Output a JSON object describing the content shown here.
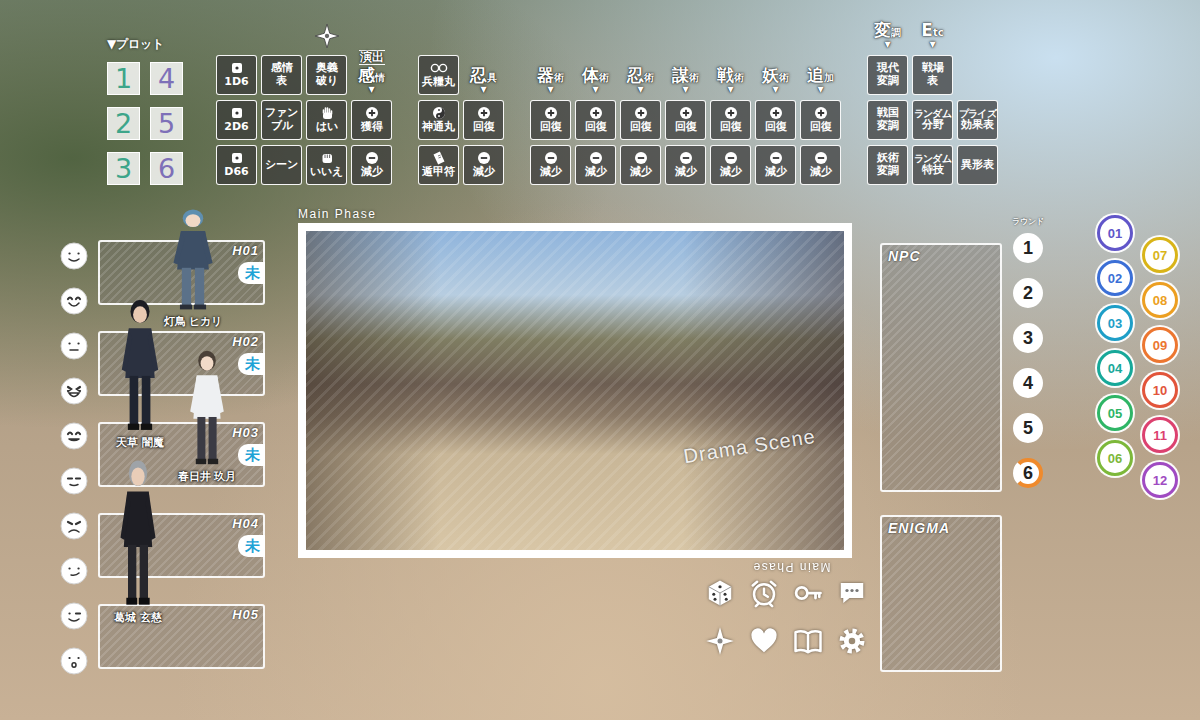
{
  "plot": {
    "title": "▼プロット",
    "numbers": [
      {
        "label": "1",
        "color": "#3da58a"
      },
      {
        "label": "2",
        "color": "#3da58a"
      },
      {
        "label": "3",
        "color": "#3da58a"
      },
      {
        "label": "4",
        "color": "#7e70b8"
      },
      {
        "label": "5",
        "color": "#7e70b8"
      },
      {
        "label": "6",
        "color": "#7e70b8"
      }
    ]
  },
  "toolGroups": [
    {
      "columns": [
        {
          "header": null,
          "buttons": [
            {
              "kind": "dice",
              "lines": [
                "1D6"
              ]
            },
            {
              "kind": "dice",
              "lines": [
                "2D6"
              ]
            },
            {
              "kind": "dice",
              "lines": [
                "D66"
              ]
            }
          ]
        },
        {
          "header": null,
          "buttons": [
            {
              "kind": "text",
              "lines": [
                "感情",
                "表"
              ]
            },
            {
              "kind": "text",
              "lines": [
                "ファン",
                "ブル"
              ]
            },
            {
              "kind": "text",
              "lines": [
                "シーン"
              ]
            }
          ]
        },
        {
          "header": {
            "kind": "shuriken"
          },
          "buttons": [
            {
              "kind": "text",
              "lines": [
                "奥義",
                "破り"
              ]
            },
            {
              "kind": "hand",
              "lines": [
                "はい"
              ]
            },
            {
              "kind": "fist",
              "lines": [
                "いいえ"
              ]
            }
          ]
        },
        {
          "header": {
            "kind": "text",
            "top": "演出",
            "main": "感",
            "sub": "情",
            "arrow": "▼"
          },
          "buttons": [
            {
              "kind": "plus",
              "lines": [
                "獲得"
              ]
            },
            {
              "kind": "minus",
              "lines": [
                "減少"
              ]
            }
          ]
        }
      ]
    },
    {
      "columns": [
        {
          "header": null,
          "buttons": [
            {
              "kind": "pill",
              "lines": [
                "兵糧丸"
              ]
            },
            {
              "kind": "yinyang",
              "lines": [
                "神通丸"
              ]
            },
            {
              "kind": "charm",
              "lines": [
                "遁甲符"
              ]
            }
          ]
        },
        {
          "header": {
            "kind": "text",
            "main": "忍",
            "sub": "具",
            "arrow": "▼"
          },
          "buttons": [
            {
              "kind": "plus",
              "lines": [
                "回復"
              ]
            },
            {
              "kind": "minus",
              "lines": [
                "減少"
              ]
            }
          ]
        }
      ]
    },
    {
      "columns": [
        {
          "header": {
            "kind": "text",
            "main": "器",
            "sub": "術",
            "arrow": "▼"
          },
          "buttons": [
            {
              "kind": "plus",
              "lines": [
                "回復"
              ]
            },
            {
              "kind": "minus",
              "lines": [
                "減少"
              ]
            }
          ]
        },
        {
          "header": {
            "kind": "text",
            "main": "体",
            "sub": "術",
            "arrow": "▼"
          },
          "buttons": [
            {
              "kind": "plus",
              "lines": [
                "回復"
              ]
            },
            {
              "kind": "minus",
              "lines": [
                "減少"
              ]
            }
          ]
        },
        {
          "header": {
            "kind": "text",
            "main": "忍",
            "sub": "術",
            "arrow": "▼"
          },
          "buttons": [
            {
              "kind": "plus",
              "lines": [
                "回復"
              ]
            },
            {
              "kind": "minus",
              "lines": [
                "減少"
              ]
            }
          ]
        },
        {
          "header": {
            "kind": "text",
            "main": "謀",
            "sub": "術",
            "arrow": "▼"
          },
          "buttons": [
            {
              "kind": "plus",
              "lines": [
                "回復"
              ]
            },
            {
              "kind": "minus",
              "lines": [
                "減少"
              ]
            }
          ]
        },
        {
          "header": {
            "kind": "text",
            "main": "戦",
            "sub": "術",
            "arrow": "▼"
          },
          "buttons": [
            {
              "kind": "plus",
              "lines": [
                "回復"
              ]
            },
            {
              "kind": "minus",
              "lines": [
                "減少"
              ]
            }
          ]
        },
        {
          "header": {
            "kind": "text",
            "main": "妖",
            "sub": "術",
            "arrow": "▼"
          },
          "buttons": [
            {
              "kind": "plus",
              "lines": [
                "回復"
              ]
            },
            {
              "kind": "minus",
              "lines": [
                "減少"
              ]
            }
          ]
        },
        {
          "header": {
            "kind": "text",
            "main": "追",
            "sub": "加",
            "arrow": "▼"
          },
          "buttons": [
            {
              "kind": "plus",
              "lines": [
                "回復"
              ]
            },
            {
              "kind": "minus",
              "lines": [
                "減少"
              ]
            }
          ]
        }
      ]
    },
    {
      "columns": [
        {
          "header": {
            "kind": "text",
            "main": "変",
            "sub": "調",
            "arrow": "▼"
          },
          "buttons": [
            {
              "kind": "text",
              "lines": [
                "現代",
                "変調"
              ]
            },
            {
              "kind": "text",
              "lines": [
                "戦国",
                "変調"
              ]
            },
            {
              "kind": "text",
              "lines": [
                "妖術",
                "変調"
              ]
            }
          ]
        },
        {
          "header": {
            "kind": "text",
            "main": "E",
            "sub": "tc",
            "arrow": "▼"
          },
          "buttons": [
            {
              "kind": "text",
              "lines": [
                "戦場",
                "表"
              ]
            },
            {
              "kind": "text",
              "lines": [
                "ランダム",
                "分野"
              ]
            },
            {
              "kind": "text",
              "lines": [
                "ランダム",
                "特技"
              ]
            }
          ]
        },
        {
          "header": null,
          "buttons": [
            {
              "kind": "text",
              "lines": [
                "プライズ",
                "効果表"
              ]
            },
            {
              "kind": "text",
              "lines": [
                "異形表"
              ]
            }
          ]
        }
      ]
    }
  ],
  "faces": [
    {
      "kind": "smile"
    },
    {
      "kind": "happy"
    },
    {
      "kind": "neutral"
    },
    {
      "kind": "laugh"
    },
    {
      "kind": "grin"
    },
    {
      "kind": "calm"
    },
    {
      "kind": "sad"
    },
    {
      "kind": "smirk"
    },
    {
      "kind": "wink"
    },
    {
      "kind": "surprise"
    }
  ],
  "slots": [
    {
      "label": "H01",
      "badge": "未"
    },
    {
      "label": "H02",
      "badge": "未"
    },
    {
      "label": "H03",
      "badge": "未"
    },
    {
      "label": "H04",
      "badge": "未"
    },
    {
      "label": "H05",
      "badge": null
    }
  ],
  "figures": [
    {
      "name": "灯鳥 ヒカリ"
    },
    {
      "name": "天草 闇魔"
    },
    {
      "name": "春日井 玖月"
    },
    {
      "name": "葛城 玄慈"
    }
  ],
  "stage": {
    "label": "Main Phase",
    "watermark": "Drama Scene",
    "mirrored_label": "Main Phase"
  },
  "dock": [
    {
      "kind": "dice"
    },
    {
      "kind": "alarm"
    },
    {
      "kind": "key"
    },
    {
      "kind": "chat"
    },
    {
      "kind": "shuriken"
    },
    {
      "kind": "heart"
    },
    {
      "kind": "book"
    },
    {
      "kind": "gear"
    }
  ],
  "npc_panel": {
    "title": "NPC"
  },
  "enigma_panel": {
    "title": "ENIGMA"
  },
  "round": {
    "title": "ラウンド",
    "items": [
      {
        "label": "1",
        "selected": false
      },
      {
        "label": "2",
        "selected": false
      },
      {
        "label": "3",
        "selected": false
      },
      {
        "label": "4",
        "selected": false
      },
      {
        "label": "5",
        "selected": false
      },
      {
        "label": "6",
        "selected": true
      }
    ]
  },
  "channels": [
    {
      "label": "01",
      "color": "#6156c9"
    },
    {
      "label": "02",
      "color": "#3b6fd6"
    },
    {
      "label": "03",
      "color": "#1e9ec7"
    },
    {
      "label": "04",
      "color": "#17a899"
    },
    {
      "label": "05",
      "color": "#2fb566"
    },
    {
      "label": "06",
      "color": "#7db83a"
    },
    {
      "label": "07",
      "color": "#d9b418"
    },
    {
      "label": "08",
      "color": "#ec9f22"
    },
    {
      "label": "09",
      "color": "#ec7630"
    },
    {
      "label": "10",
      "color": "#e2553b"
    },
    {
      "label": "11",
      "color": "#dc416f"
    },
    {
      "label": "12",
      "color": "#a04bc2"
    }
  ]
}
